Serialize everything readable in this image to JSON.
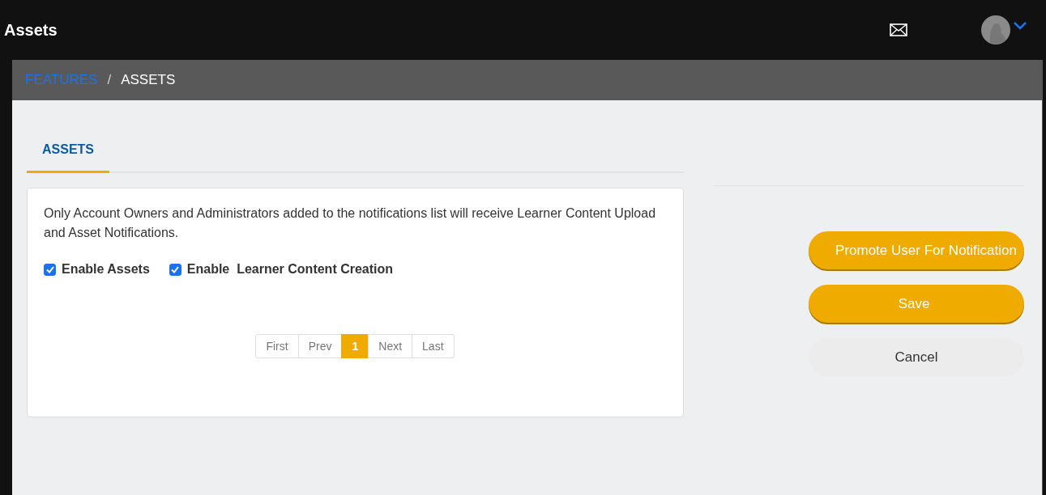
{
  "header": {
    "title": "Assets"
  },
  "breadcrumb": [
    {
      "label": "FEATURES",
      "kind": "link"
    },
    {
      "label": "/",
      "kind": "separator"
    },
    {
      "label": "ASSETS",
      "kind": "current"
    }
  ],
  "tabs": [
    {
      "label": "ASSETS",
      "selected": true
    }
  ],
  "notice": "Only Account Owners and Administrators added to the notifications list will receive Learner Content Upload and Asset Notifications.",
  "options": [
    {
      "label": "Enable Assets",
      "checked": true
    },
    {
      "label": "Enable  Learner Content Creation",
      "checked": true
    }
  ],
  "pagination": [
    {
      "label": "First",
      "selected": false
    },
    {
      "label": "Prev",
      "selected": false
    },
    {
      "label": "1",
      "selected": true
    },
    {
      "label": "Next",
      "selected": false
    },
    {
      "label": "Last",
      "selected": false
    }
  ],
  "buttons": [
    {
      "label": "Promote User For Notification",
      "kind": "primary"
    },
    {
      "label": "Save",
      "kind": "primary"
    },
    {
      "label": "Cancel",
      "kind": "secondary"
    }
  ]
}
